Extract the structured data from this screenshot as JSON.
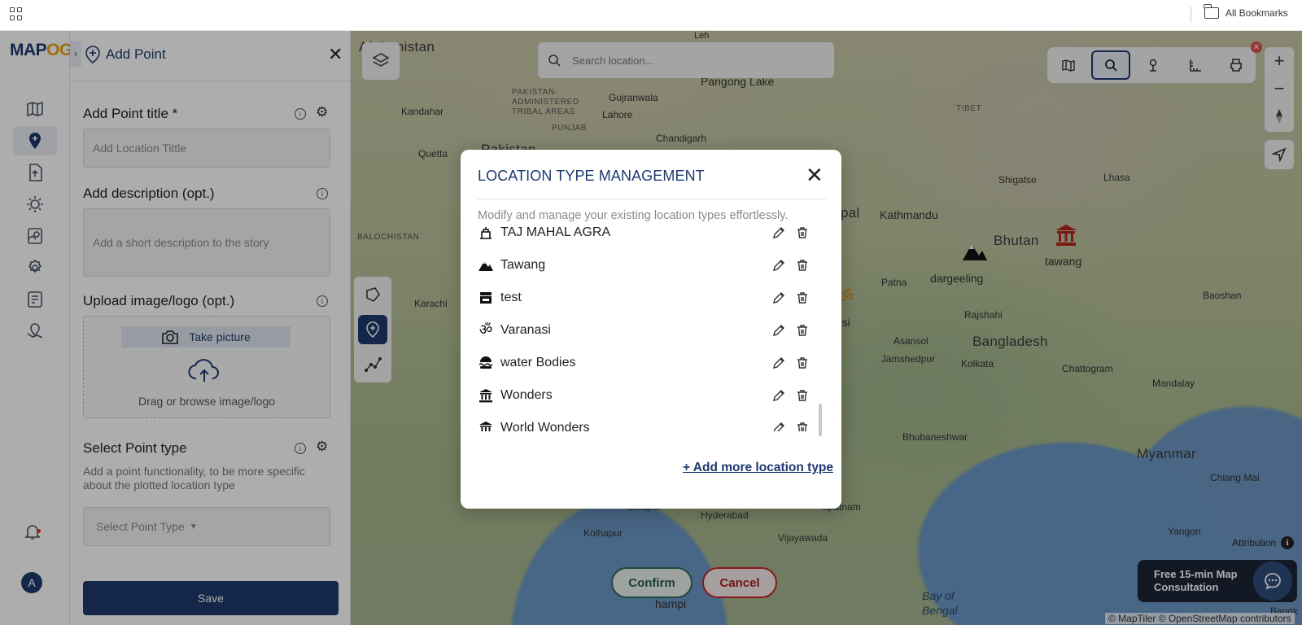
{
  "topbar": {
    "bookmarks_label": "All Bookmarks"
  },
  "brand": {
    "logo_main": "MAP",
    "logo_accent": "OG"
  },
  "panel": {
    "title": "Add Point",
    "title_label": "Add Point title *",
    "title_placeholder": "Add Location Tittle",
    "description_label": "Add description (opt.)",
    "description_placeholder": "Add a short description to the story",
    "upload_label": "Upload image/logo (opt.)",
    "take_picture": "Take picture",
    "drag_text": "Drag or browse image/logo",
    "point_type_label": "Select Point type",
    "point_type_help": "Add a point functionality, to be more specific about the plotted location type",
    "point_type_placeholder": "Select Point Type",
    "save_label": "Save"
  },
  "user": {
    "avatar_initial": "A"
  },
  "map": {
    "search_placeholder": "Search location...",
    "confirm_label": "Confirm",
    "cancel_label": "Cancel",
    "attribution_label": "Attribution",
    "consultation_line1": "Free 15-min Map",
    "consultation_line2": "Consultation",
    "copyright": "© MapTiler © OpenStreetMap contributors",
    "labels": {
      "afghanistan": "Afghanistan",
      "leh": "Leh",
      "pangong": "Pangong Lake",
      "pakistan_admin": "PAKISTAN- ADMINISTERED TRIBAL AREAS",
      "kandahar": "Kandahar",
      "gujranwala": "Gujranwala",
      "lahore": "Lahore",
      "punjab": "PUNJAB",
      "chandigarh": "Chandigarh",
      "tibet": "TIBET",
      "quetta": "Quetta",
      "pakistan": "Pakistan",
      "shigatse": "Shigatse",
      "lhasa": "Lhasa",
      "nepal": "pal",
      "kathmandu": "Kathmandu",
      "bhutan": "Bhutan",
      "tawang": "tawang",
      "balochistan": "BALOCHISTAN",
      "dargeeling": "dargeeling",
      "patna": "Patna",
      "baoshan": "Baoshan",
      "karachi": "Karachi",
      "varanasi_partial": "nasi",
      "rajshahi": "Rajshahi",
      "asansol": "Asansol",
      "bangladesh": "Bangladesh",
      "jamshedpur": "Jamshedpur",
      "kolkata": "Kolkata",
      "chattogram": "Chattogram",
      "mandalay": "Mandalay",
      "bhubaneshwar": "Bhubaneshwar",
      "myanmar": "Myanmar",
      "chiang_mai": "Chiang Mai",
      "solapur": "Solapur",
      "hyderabad": "Hyderabad",
      "kolhapur": "Kolhapur",
      "vijayawada": "Vijayawada",
      "apatnam": "apatnam",
      "yangon": "Yangon",
      "hampi": "hampi",
      "bay_of_bengal_1": "Bay of",
      "bay_of_bengal_2": "Bengal",
      "bangk": "Bangk"
    }
  },
  "modal": {
    "title": "LOCATION TYPE MANAGEMENT",
    "subtitle": "Modify and manage your existing location types effortlessly.",
    "items": [
      {
        "name": "TAJ MAHAL AGRA",
        "icon": "monument-icon"
      },
      {
        "name": "Tawang",
        "icon": "mountain-icon"
      },
      {
        "name": "test",
        "icon": "store-icon"
      },
      {
        "name": "Varanasi",
        "icon": "om-icon"
      },
      {
        "name": "water Bodies",
        "icon": "water-icon"
      },
      {
        "name": "Wonders",
        "icon": "landmark-icon"
      },
      {
        "name": "World Wonders",
        "icon": "landmark-icon"
      }
    ],
    "add_more": "+ Add more location type"
  },
  "colors": {
    "brand": "#1e3a6e",
    "accent": "#e6a21a",
    "confirm": "#2b6b5a",
    "cancel": "#c22222"
  }
}
